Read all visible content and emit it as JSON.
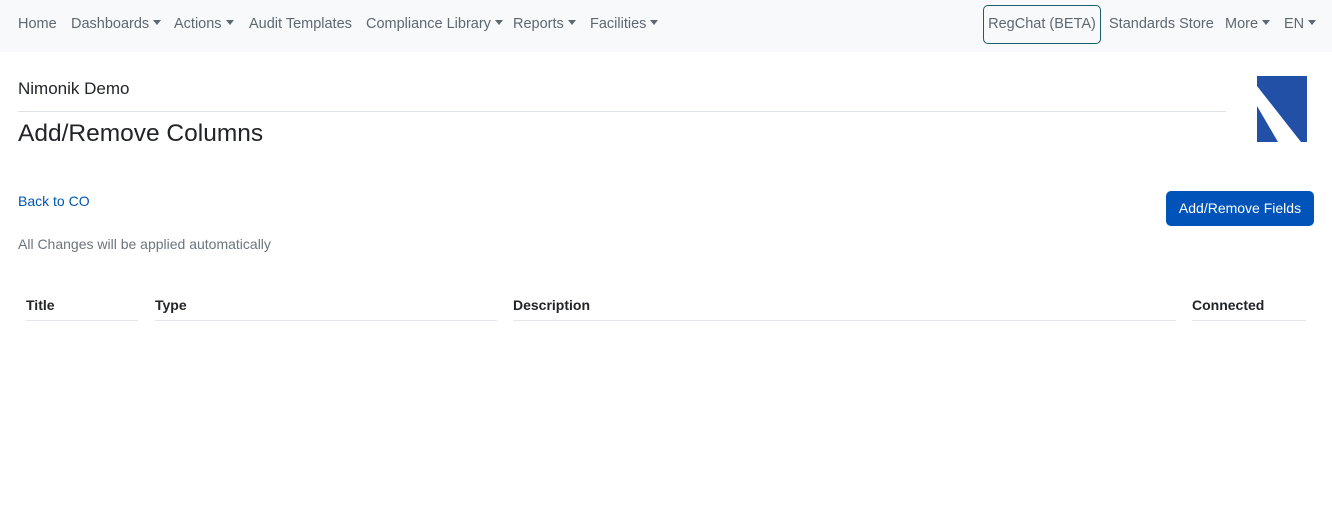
{
  "nav": {
    "home": "Home",
    "dashboards": "Dashboards",
    "actions": "Actions",
    "audit_templates": "Audit Templates",
    "compliance_library": "Compliance Library",
    "reports": "Reports",
    "facilities": "Facilities",
    "regchat": "RegChat (BETA)",
    "standards_store": "Standards Store",
    "more": "More",
    "language": "EN"
  },
  "header": {
    "organization": "Nimonik Demo",
    "title": "Add/Remove Columns"
  },
  "main": {
    "back_link": "Back to CO",
    "note": "All Changes will be applied automatically",
    "add_remove_fields_button": "Add/Remove Fields"
  },
  "table": {
    "columns": [
      "Title",
      "Type",
      "Description",
      "Connected"
    ]
  },
  "colors": {
    "brand_blue": "#2150a6",
    "primary_button": "#0053b8",
    "link": "#0056b3",
    "navbar_bg": "#f8f9fa"
  }
}
